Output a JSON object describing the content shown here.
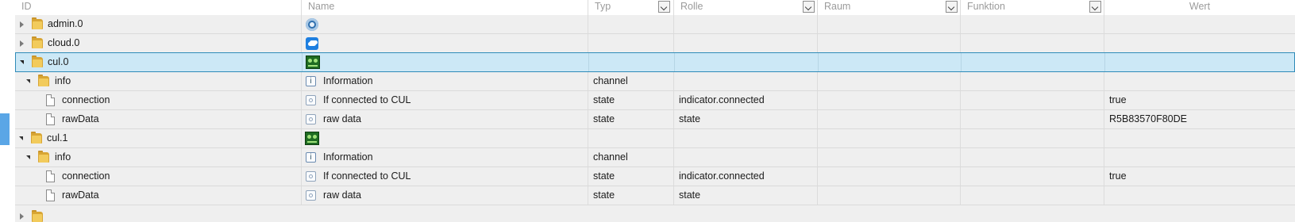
{
  "columns": {
    "id": "ID",
    "name": "Name",
    "typ": "Typ",
    "rolle": "Rolle",
    "raum": "Raum",
    "funktion": "Funktion",
    "wert": "Wert"
  },
  "rows": [
    {
      "id": "admin.0",
      "name": "",
      "typ": "",
      "rolle": "",
      "wert": "",
      "icon": "adapter-admin-icon"
    },
    {
      "id": "cloud.0",
      "name": "",
      "typ": "",
      "rolle": "",
      "wert": "",
      "icon": "adapter-cloud-icon"
    },
    {
      "id": "cul.0",
      "name": "",
      "typ": "",
      "rolle": "",
      "wert": "",
      "icon": "adapter-cul-icon"
    },
    {
      "id": "info",
      "name": "Information",
      "typ": "channel",
      "rolle": "",
      "wert": "",
      "icon": "info-icon"
    },
    {
      "id": "connection",
      "name": "If connected to CUL",
      "typ": "state",
      "rolle": "indicator.connected",
      "wert": "true",
      "icon": "state-icon"
    },
    {
      "id": "rawData",
      "name": "raw data",
      "typ": "state",
      "rolle": "state",
      "wert": "R5B83570F80DE",
      "icon": "state-icon"
    },
    {
      "id": "cul.1",
      "name": "",
      "typ": "",
      "rolle": "",
      "wert": "",
      "icon": "adapter-cul-icon"
    },
    {
      "id": "info",
      "name": "Information",
      "typ": "channel",
      "rolle": "",
      "wert": "",
      "icon": "info-icon"
    },
    {
      "id": "connection",
      "name": "If connected to CUL",
      "typ": "state",
      "rolle": "indicator.connected",
      "wert": "true",
      "icon": "state-icon"
    },
    {
      "id": "rawData",
      "name": "raw data",
      "typ": "state",
      "rolle": "state",
      "wert": "",
      "icon": "state-icon"
    }
  ],
  "info_glyph": "i"
}
